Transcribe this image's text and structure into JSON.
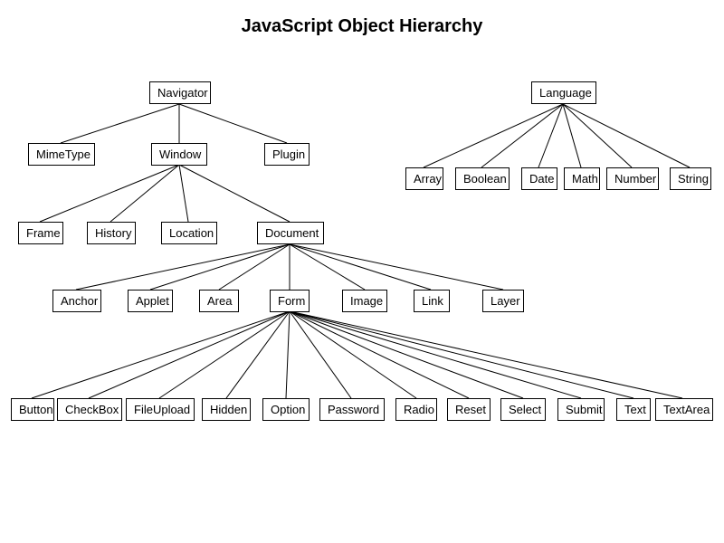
{
  "title": "JavaScript Object Hierarchy",
  "nodes": {
    "navigator": "Navigator",
    "language": "Language",
    "mimetype": "MimeType",
    "window": "Window",
    "plugin": "Plugin",
    "array": "Array",
    "boolean": "Boolean",
    "date": "Date",
    "math": "Math",
    "number": "Number",
    "string": "String",
    "frame": "Frame",
    "history": "History",
    "location": "Location",
    "document": "Document",
    "anchor": "Anchor",
    "applet": "Applet",
    "area": "Area",
    "form": "Form",
    "image": "Image",
    "link": "Link",
    "layer": "Layer",
    "button": "Button",
    "checkbox": "CheckBox",
    "fileupload": "FileUpload",
    "hidden": "Hidden",
    "option": "Option",
    "password": "Password",
    "radio": "Radio",
    "reset": "Reset",
    "select": "Select",
    "submit": "Submit",
    "text": "Text",
    "textarea": "TextArea"
  }
}
